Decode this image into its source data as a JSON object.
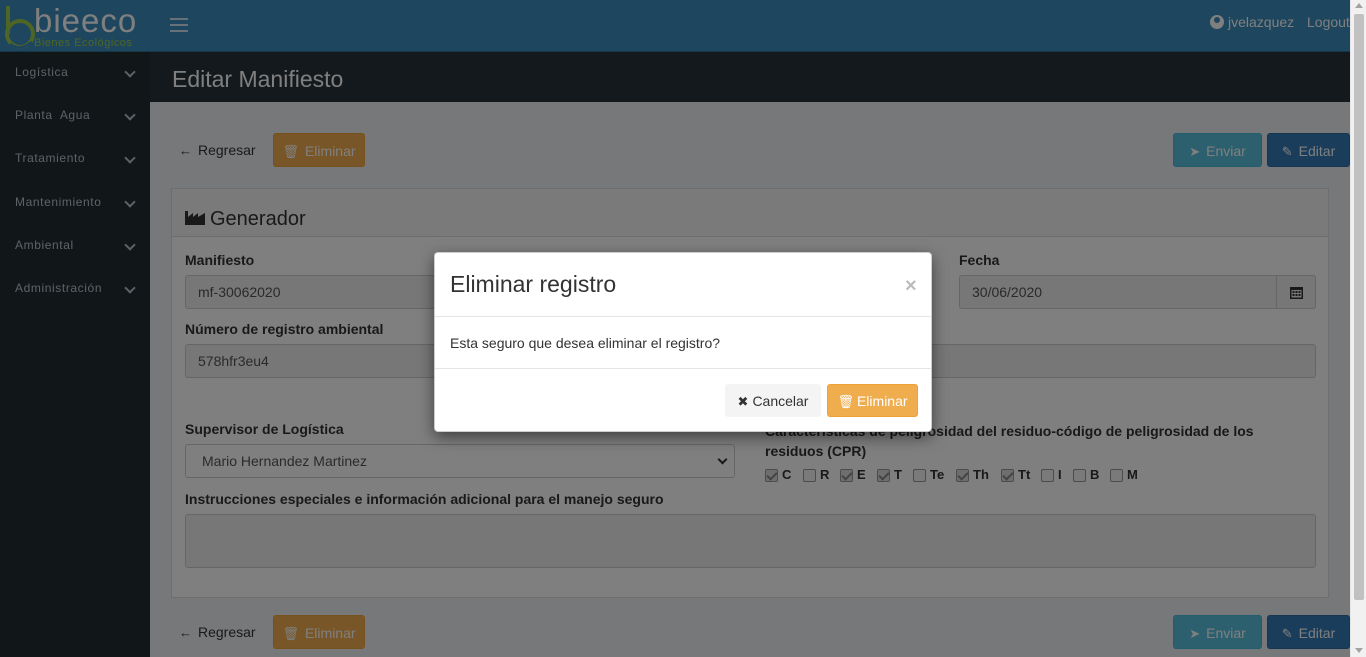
{
  "app": {
    "logo_text": "bieeco",
    "logo_subtitle": "Bienes Ecológicos",
    "user": "jvelazquez",
    "logout": "Logout"
  },
  "sidebar": {
    "items": [
      {
        "label": "Logística"
      },
      {
        "label": "Planta  Agua"
      },
      {
        "label": "Tratamiento"
      },
      {
        "label": "Mantenimiento"
      },
      {
        "label": "Ambiental"
      },
      {
        "label": "Administración"
      }
    ]
  },
  "page": {
    "title": "Editar Manifiesto"
  },
  "toolbar": {
    "back": "Regresar",
    "delete": "Eliminar",
    "send": "Enviar",
    "edit": "Editar"
  },
  "panel": {
    "title": "Generador",
    "manifiesto_label": "Manifiesto",
    "manifiesto_value": "mf-30062020",
    "fecha_label": "Fecha",
    "fecha_value": "30/06/2020",
    "registro_label": "Número de registro ambiental",
    "registro_value": "578hfr3eu4",
    "supervisor_label": "Supervisor de Logística",
    "supervisor_value": "Mario Hernandez Martinez",
    "caracteristicas_label": "Características de peligrosidad del residuo-código de peligrosidad de los residuos (CPR)",
    "instrucciones_label": "Instrucciones especiales e información adicional para el manejo seguro",
    "instrucciones_value": "",
    "checkboxes": [
      {
        "label": "C",
        "checked": true
      },
      {
        "label": "R",
        "checked": false
      },
      {
        "label": "E",
        "checked": true
      },
      {
        "label": "T",
        "checked": true
      },
      {
        "label": "Te",
        "checked": false
      },
      {
        "label": "Th",
        "checked": true
      },
      {
        "label": "Tt",
        "checked": true
      },
      {
        "label": "I",
        "checked": false
      },
      {
        "label": "B",
        "checked": false
      },
      {
        "label": "M",
        "checked": false
      }
    ]
  },
  "modal": {
    "title": "Eliminar registro",
    "close": "×",
    "body": "Esta seguro que desea eliminar el registro?",
    "cancel": "Cancelar",
    "confirm": "Eliminar"
  },
  "colors": {
    "topbar": "#3c8dbc",
    "sidebar": "#222d32",
    "warning": "#f0ad4e",
    "info": "#5bc0de",
    "primary": "#337ab7"
  }
}
